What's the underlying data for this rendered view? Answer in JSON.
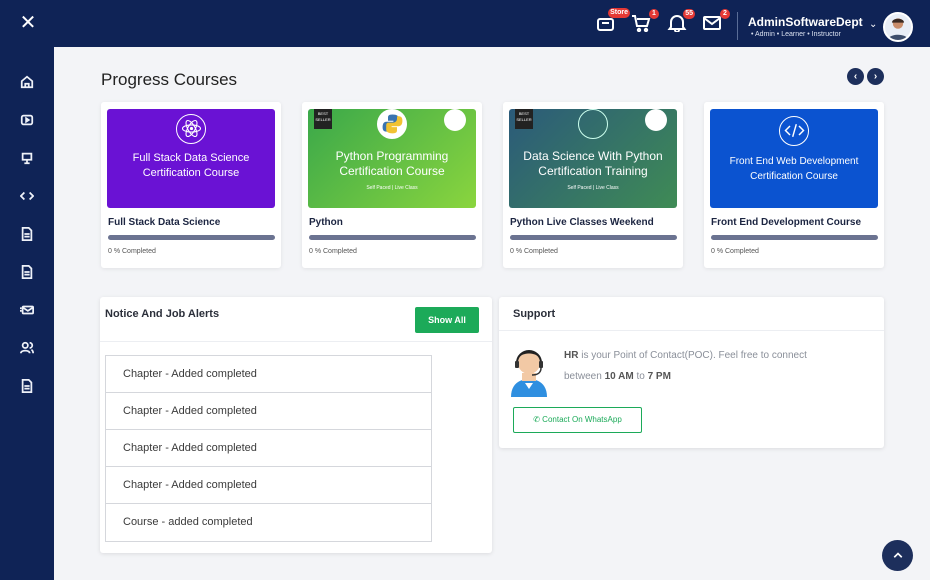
{
  "header": {
    "store_badge": "Store",
    "cart_badge": "1",
    "bell_badge": "55",
    "mail_badge": "2",
    "user_name": "AdminSoftwareDept",
    "user_roles": "• Admin • Learner • Instructor"
  },
  "sidebar": {
    "items": [
      {
        "icon": "home-icon"
      },
      {
        "icon": "video-icon"
      },
      {
        "icon": "presentation-icon"
      },
      {
        "icon": "code-icon"
      },
      {
        "icon": "document-icon"
      },
      {
        "icon": "document-icon"
      },
      {
        "icon": "mail-icon"
      },
      {
        "icon": "users-icon"
      },
      {
        "icon": "document-icon"
      }
    ]
  },
  "progress": {
    "title": "Progress Courses",
    "courses": [
      {
        "thumb_title": "Full Stack Data Science Certification Course",
        "name": "Full Stack Data Science",
        "progress": 0,
        "progress_label": "0 % Completed",
        "color": "#6a12d4"
      },
      {
        "thumb_title": "Python Programming Certification Course",
        "thumb_sub": "Self Paced | Live Class",
        "best_seller": "BEST SELLER",
        "name": "Python",
        "progress": 0,
        "progress_label": "0 % Completed",
        "color": "#5ec441"
      },
      {
        "thumb_title": "Data Science With Python Certification Training",
        "thumb_sub": "Self Paced | Live Class",
        "best_seller": "BEST SELLER",
        "name": "Python Live Classes Weekend",
        "progress": 0,
        "progress_label": "0 % Completed",
        "color": "#1f6e5f"
      },
      {
        "thumb_title": "Front End Web Development Certification Course",
        "name": "Front End Development Course",
        "progress": 0,
        "progress_label": "0 % Completed",
        "color": "#0b53d0"
      }
    ]
  },
  "notices": {
    "title": "Notice And Job Alerts",
    "show_all": "Show All",
    "items": [
      "Chapter - Added completed",
      "Chapter - Added completed",
      "Chapter - Added completed",
      "Chapter - Added completed",
      "Course - added completed"
    ]
  },
  "support": {
    "title": "Support",
    "hr": "HR",
    "text1": "is your Point of Contact(POC). Feel free to connect",
    "text2": "between",
    "from": "10 AM",
    "to_word": "to",
    "until": "7 PM",
    "whatsapp": "Contact On WhatsApp"
  }
}
